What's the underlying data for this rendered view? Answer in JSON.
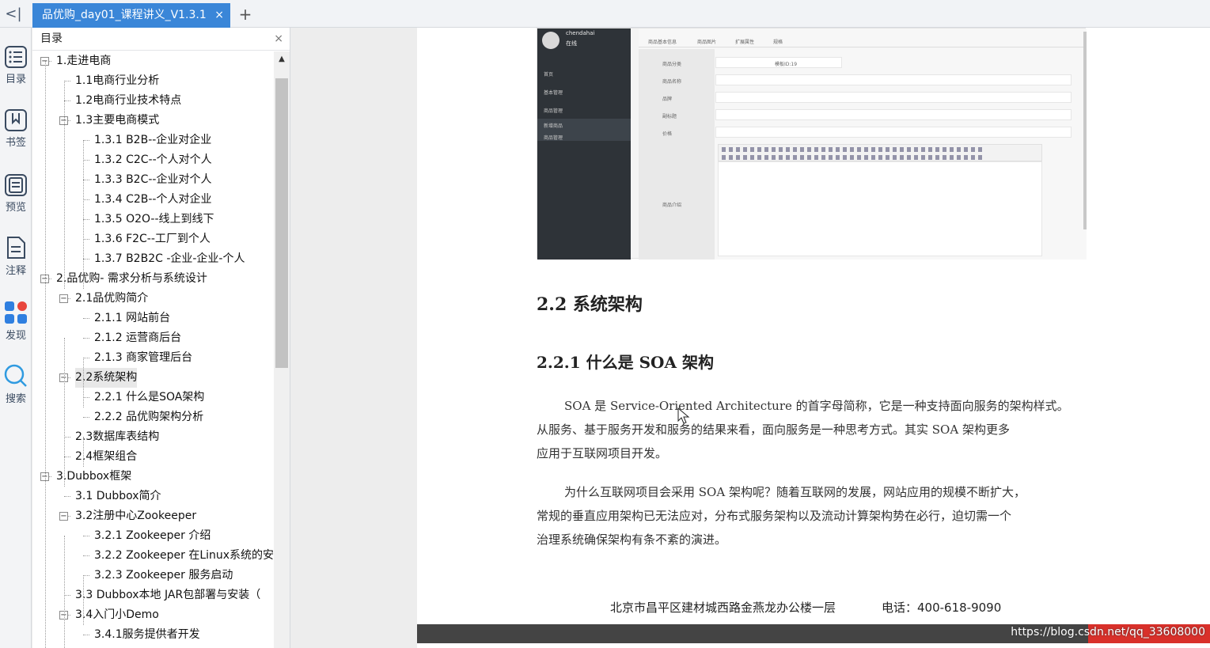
{
  "tabbar": {
    "tab_title": "品优购_day01_课程讲义_V1.3.1",
    "close_glyph": "×",
    "new_tab_glyph": "+",
    "back_glyph": "<|"
  },
  "rail": {
    "items": [
      {
        "label": "目录",
        "icon": "toc-icon"
      },
      {
        "label": "书签",
        "icon": "bookmark-icon"
      },
      {
        "label": "预览",
        "icon": "preview-icon"
      },
      {
        "label": "注释",
        "icon": "annotation-icon"
      },
      {
        "label": "发现",
        "icon": "discover-icon"
      },
      {
        "label": "搜索",
        "icon": "search-icon"
      }
    ]
  },
  "toc": {
    "header": "目录",
    "close_glyph": "×",
    "items": [
      {
        "text": "1.走进电商",
        "level": 0,
        "toggle": "−"
      },
      {
        "text": "1.1电商行业分析",
        "level": 1
      },
      {
        "text": "1.2电商行业技术特点",
        "level": 1
      },
      {
        "text": "1.3主要电商模式",
        "level": 1,
        "toggle": "−"
      },
      {
        "text": "1.3.1  B2B--企业对企业",
        "level": 2
      },
      {
        "text": "1.3.2  C2C--个人对个人",
        "level": 2
      },
      {
        "text": "1.3.3  B2C--企业对个人",
        "level": 2
      },
      {
        "text": "1.3.4  C2B--个人对企业",
        "level": 2
      },
      {
        "text": "1.3.5  O2O--线上到线下",
        "level": 2
      },
      {
        "text": "1.3.6  F2C--工厂到个人",
        "level": 2
      },
      {
        "text": "1.3.7  B2B2C -企业-企业-个人",
        "level": 2
      },
      {
        "text": "2.品优购- 需求分析与系统设计",
        "level": 0,
        "toggle": "−"
      },
      {
        "text": "2.1品优购简介",
        "level": 1,
        "toggle": "−"
      },
      {
        "text": "2.1.1  网站前台",
        "level": 2
      },
      {
        "text": "2.1.2  运营商后台",
        "level": 2
      },
      {
        "text": "2.1.3  商家管理后台",
        "level": 2
      },
      {
        "text": "2.2系统架构",
        "level": 1,
        "toggle": "−",
        "selected": true
      },
      {
        "text": "2.2.1  什么是SOA架构",
        "level": 2
      },
      {
        "text": "2.2.2  品优购架构分析",
        "level": 2
      },
      {
        "text": "2.3数据库表结构",
        "level": 1
      },
      {
        "text": "2.4框架组合",
        "level": 1
      },
      {
        "text": "3.Dubbox框架",
        "level": 0,
        "toggle": "−"
      },
      {
        "text": "3.1 Dubbox简介",
        "level": 1
      },
      {
        "text": "3.2注册中心Zookeeper",
        "level": 1,
        "toggle": "−"
      },
      {
        "text": "3.2.1 Zookeeper 介绍",
        "level": 2
      },
      {
        "text": "3.2.2 Zookeeper 在Linux系统的安",
        "level": 2
      },
      {
        "text": "3.2.3 Zookeeper 服务启动",
        "level": 2
      },
      {
        "text": "3.3 Dubbox本地 JAR包部署与安装（",
        "level": 1
      },
      {
        "text": "3.4入门小Demo",
        "level": 1,
        "toggle": "−"
      },
      {
        "text": "3.4.1服务提供者开发",
        "level": 2
      }
    ]
  },
  "document": {
    "screenshot": {
      "username": "chendahai",
      "status": "在线",
      "menu": [
        "首页",
        "基本管理",
        "商品管理",
        "新增商品",
        "商品管理"
      ],
      "tabs": [
        "商品基本信息",
        "商品图片",
        "扩展属性",
        "规格"
      ],
      "labels": [
        "商品分类",
        "商品名称",
        "品牌",
        "副标题",
        "价格",
        "商品介绍"
      ],
      "template_id": "模板ID:19"
    },
    "h2": "2.2 系统架构",
    "h3": "2.2.1  什么是 SOA 架构",
    "para1": [
      "SOA 是 Service-Oriented Architecture 的首字母简称，它是一种支持面向服务的架构样式。",
      "从服务、基于服务开发和服务的结果来看，面向服务是一种思考方式。其实 SOA 架构更多",
      "应用于互联网项目开发。"
    ],
    "para2": [
      "为什么互联网项目会采用 SOA 架构呢？随着互联网的发展，网站应用的规模不断扩大，",
      "常规的垂直应用架构已无法应对，分布式服务架构以及流动计算架构势在必行，迫切需一个",
      "治理系统确保架构有条不紊的演进。"
    ],
    "footer_address": "北京市昌平区建材城西路金燕龙办公楼一层",
    "footer_phone": "电话：400-618-9090",
    "watermark": "https://blog.csdn.net/qq_33608000"
  }
}
